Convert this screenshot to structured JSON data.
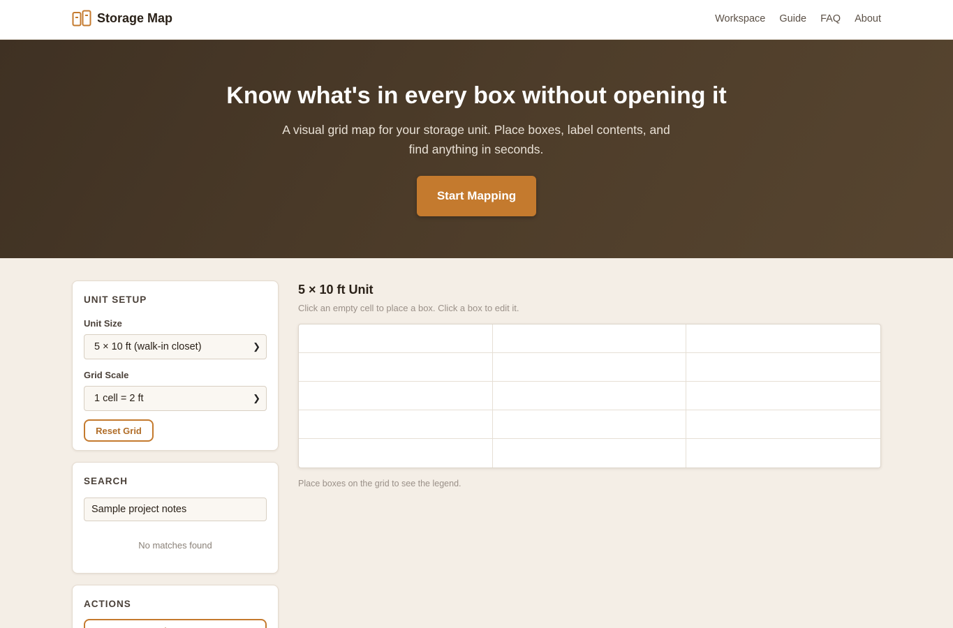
{
  "header": {
    "brand": "Storage Map",
    "logo_icon": "storage-boxes-icon",
    "nav": [
      "Workspace",
      "Guide",
      "FAQ",
      "About"
    ]
  },
  "hero": {
    "title": "Know what's in every box without opening it",
    "subtitle": "A visual grid map for your storage unit. Place boxes, label contents, and find anything in seconds.",
    "cta": "Start Mapping"
  },
  "unit_setup": {
    "title": "UNIT SETUP",
    "unit_size_label": "Unit Size",
    "unit_size_value": "5 × 10 ft (walk-in closet)",
    "grid_scale_label": "Grid Scale",
    "grid_scale_value": "1 cell = 2 ft",
    "reset_label": "Reset Grid"
  },
  "search": {
    "title": "SEARCH",
    "value": "Sample project notes",
    "empty_text": "No matches found"
  },
  "actions": {
    "title": "ACTIONS",
    "print_label": "Print Map"
  },
  "main": {
    "unit_title": "5 × 10 ft Unit",
    "hint": "Click an empty cell to place a box. Click a box to edit it.",
    "grid_cols": 3,
    "grid_rows": 5,
    "legend_text": "Place boxes on the grid to see the legend."
  },
  "colors": {
    "accent": "#c47a2e",
    "hero_bg": "#4a3a28",
    "page_bg": "#f4eee6"
  }
}
